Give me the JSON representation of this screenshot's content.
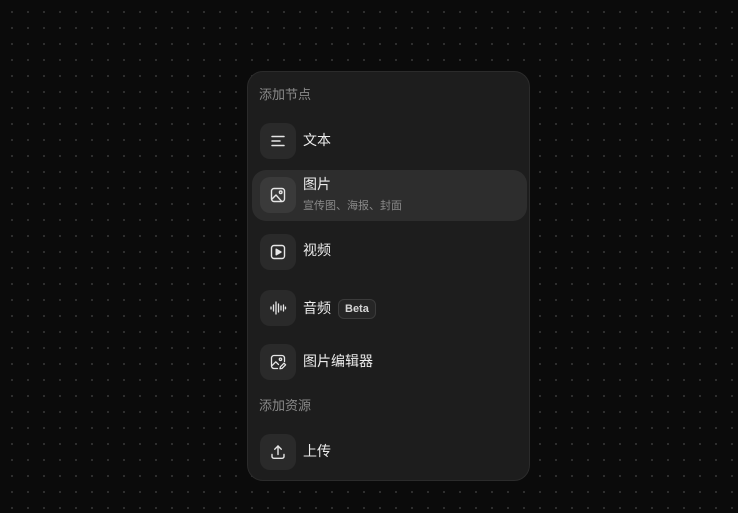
{
  "menu": {
    "section_nodes": "添加节点",
    "section_assets": "添加资源",
    "items": [
      {
        "label": "文本",
        "icon": "text-lines-icon"
      },
      {
        "label": "图片",
        "sublabel": "宣传图、海报、封面",
        "icon": "image-icon"
      },
      {
        "label": "视频",
        "icon": "video-play-icon"
      },
      {
        "label": "音频",
        "badge": "Beta",
        "icon": "audio-waveform-icon"
      },
      {
        "label": "图片编辑器",
        "icon": "image-edit-icon"
      }
    ],
    "assets": [
      {
        "label": "上传",
        "icon": "upload-icon"
      }
    ]
  },
  "colors": {
    "background": "#0b0b0b",
    "panel": "#1d1d1d",
    "hover": "#2d2d2d",
    "icon_tile": "#2a2a2a"
  }
}
